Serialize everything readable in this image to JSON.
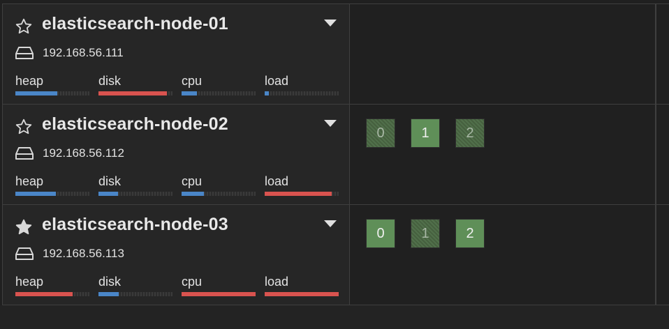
{
  "colors": {
    "blue": "#4a86c8",
    "red": "#d9534f",
    "shard_green": "#5f8f58"
  },
  "nodes": [
    {
      "name": "elasticsearch-node-01",
      "ip": "192.168.56.111",
      "master": false,
      "metrics": [
        {
          "label": "heap",
          "fraction": 0.57,
          "color": "#4a86c8"
        },
        {
          "label": "disk",
          "fraction": 0.92,
          "color": "#d9534f"
        },
        {
          "label": "cpu",
          "fraction": 0.21,
          "color": "#4a86c8"
        },
        {
          "label": "load",
          "fraction": 0.06,
          "color": "#4a86c8"
        }
      ],
      "shards": []
    },
    {
      "name": "elasticsearch-node-02",
      "ip": "192.168.56.112",
      "master": false,
      "metrics": [
        {
          "label": "heap",
          "fraction": 0.55,
          "color": "#4a86c8"
        },
        {
          "label": "disk",
          "fraction": 0.26,
          "color": "#4a86c8"
        },
        {
          "label": "cpu",
          "fraction": 0.3,
          "color": "#4a86c8"
        },
        {
          "label": "load",
          "fraction": 0.91,
          "color": "#d9534f"
        }
      ],
      "shards": [
        {
          "label": "0",
          "primary": false
        },
        {
          "label": "1",
          "primary": true
        },
        {
          "label": "2",
          "primary": false
        }
      ]
    },
    {
      "name": "elasticsearch-node-03",
      "ip": "192.168.56.113",
      "master": true,
      "metrics": [
        {
          "label": "heap",
          "fraction": 0.77,
          "color": "#d9534f"
        },
        {
          "label": "disk",
          "fraction": 0.27,
          "color": "#4a86c8"
        },
        {
          "label": "cpu",
          "fraction": 1.0,
          "color": "#d9534f"
        },
        {
          "label": "load",
          "fraction": 1.0,
          "color": "#d9534f"
        }
      ],
      "shards": [
        {
          "label": "0",
          "primary": true
        },
        {
          "label": "1",
          "primary": false
        },
        {
          "label": "2",
          "primary": true
        }
      ]
    }
  ]
}
